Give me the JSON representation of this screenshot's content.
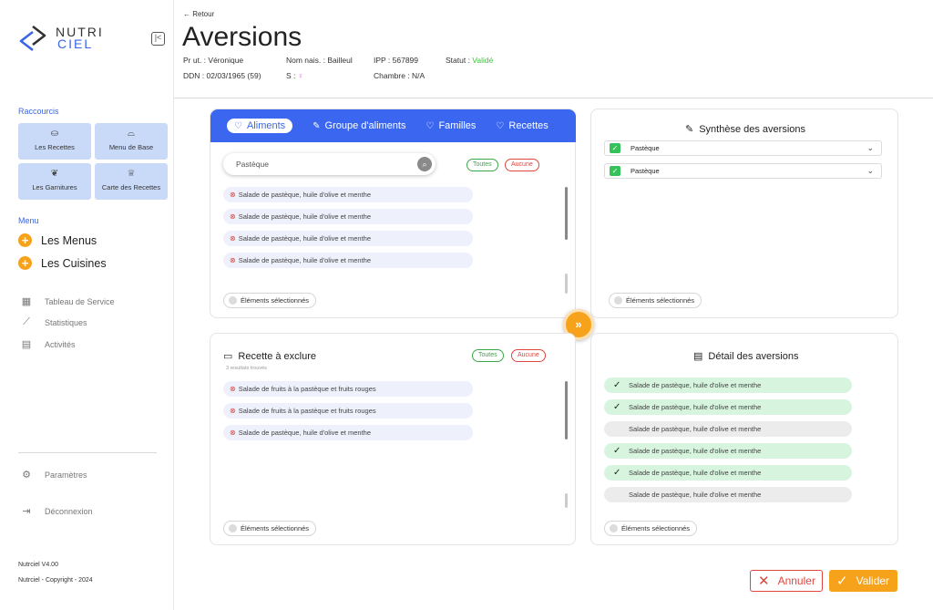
{
  "app": {
    "logo_line1": "NUTRI",
    "logo_line2": "CIEL"
  },
  "sidebar": {
    "shortcuts_title": "Raccourcis",
    "shortcuts": [
      {
        "label": "Les Recettes",
        "icon": "pot-icon"
      },
      {
        "label": "Menu de Base",
        "icon": "cloche-icon"
      },
      {
        "label": "Les Garnitures",
        "icon": "leaf-icon"
      },
      {
        "label": "Carte des Recettes",
        "icon": "chef-hat-icon"
      }
    ],
    "menu_title": "Menu",
    "menu_items": [
      {
        "label": "Les Menus"
      },
      {
        "label": "Les Cuisines"
      }
    ],
    "nav_items": [
      {
        "label": "Tableau de Service",
        "icon": "table-icon"
      },
      {
        "label": "Statistiques",
        "icon": "chart-icon"
      },
      {
        "label": "Activités",
        "icon": "clipboard-icon"
      }
    ],
    "settings_label": "Paramètres",
    "logout_label": "Déconnexion",
    "version": "Nutrciel V4.00",
    "copyright": "Nutrciel - Copyright - 2024"
  },
  "header": {
    "back_label": "← Retour",
    "title": "Aversions",
    "pr_label": "Pr ut. : ",
    "pr_value": "Véronique",
    "nom_label": "Nom nais. : ",
    "nom_value": "Bailleul",
    "ipp_label": "IPP : ",
    "ipp_value": "567899",
    "statut_label": "Statut : ",
    "statut_value": "Validé",
    "ddn_label": "DDN : ",
    "ddn_value": "02/03/1965 (59)",
    "sexe_label": "S : ",
    "sexe_value": "♀",
    "chambre_label": "Chambre : ",
    "chambre_value": "N/A"
  },
  "food_panel": {
    "tabs": [
      "Aliments",
      "Groupe d'aliments",
      "Familles",
      "Recettes"
    ],
    "search_value": "Pastèque",
    "all_label": "Toutes",
    "none_label": "Aucune",
    "items": [
      "Salade de pastèque, huile d'olive et menthe",
      "Salade de pastèque, huile d'olive et menthe",
      "Salade de pastèque, huile d'olive et menthe",
      "Salade de pastèque, huile d'olive et menthe"
    ],
    "selected_label": "Éléments sélectionnés"
  },
  "exclude_panel": {
    "title": "Recette à exclure",
    "results_note": "3 resultats trouvés",
    "all_label": "Toutes",
    "none_label": "Aucune",
    "items": [
      "Salade de fruits à la pastèque et fruits rouges",
      "Salade de fruits à la pastèque et fruits rouges",
      "Salade de pastèque, huile d'olive et menthe"
    ],
    "selected_label": "Éléments sélectionnés"
  },
  "synthesis_panel": {
    "title": "Synthèse des aversions",
    "rows": [
      "Pastèque",
      "Pastèque"
    ],
    "selected_label": "Éléments sélectionnés"
  },
  "detail_panel": {
    "title": "Détail des aversions",
    "rows": [
      {
        "label": "Salade de pastèque, huile d'olive et menthe",
        "checked": true
      },
      {
        "label": "Salade de pastèque, huile d'olive et menthe",
        "checked": true
      },
      {
        "label": "Salade de pastèque, huile d'olive et menthe",
        "checked": false
      },
      {
        "label": "Salade de pastèque, huile d'olive et menthe",
        "checked": true
      },
      {
        "label": "Salade de pastèque, huile d'olive et menthe",
        "checked": true
      },
      {
        "label": "Salade de pastèque, huile d'olive et menthe",
        "checked": false
      }
    ],
    "selected_label": "Éléments sélectionnés"
  },
  "actions": {
    "cancel_label": "Annuler",
    "validate_label": "Valider"
  },
  "colors": {
    "primary": "#3a66f0",
    "accent": "#f7a21b",
    "success": "#3cc23c",
    "danger": "#e0463c"
  }
}
